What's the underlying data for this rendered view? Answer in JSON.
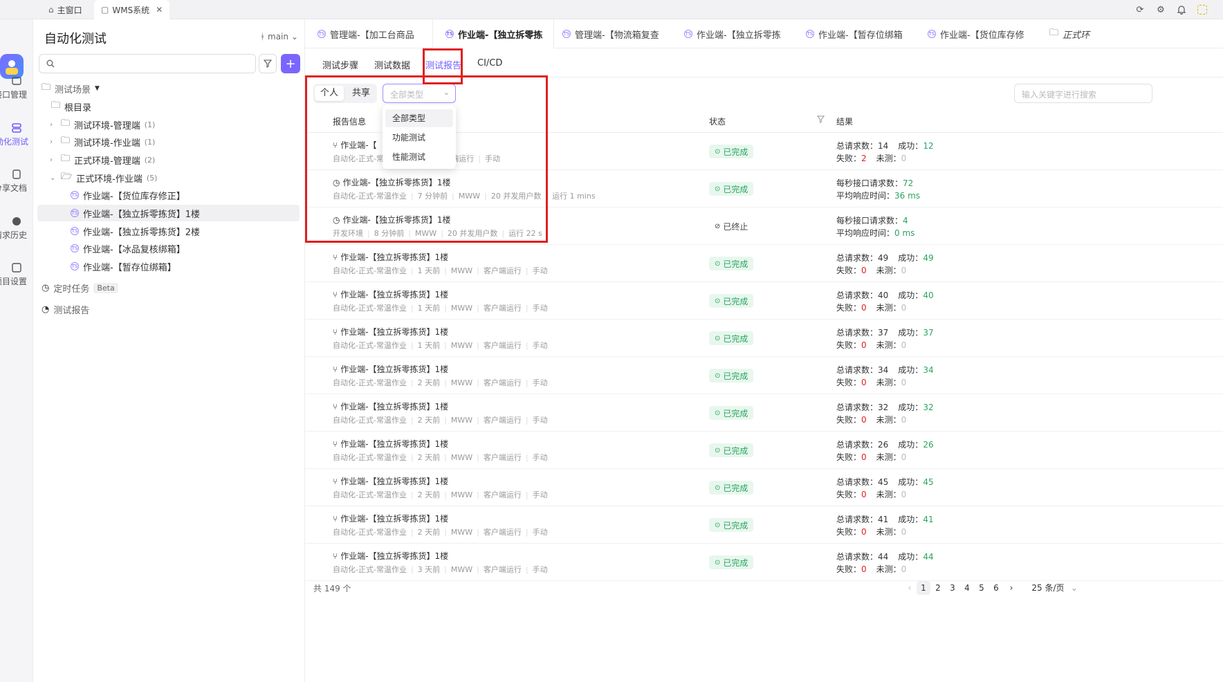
{
  "window": {
    "tabs": [
      {
        "label": "主窗口"
      },
      {
        "label": "WMS系统"
      }
    ]
  },
  "rail": {
    "items": [
      {
        "label": "接口管理"
      },
      {
        "label": "自动化测试"
      },
      {
        "label": "分享文档"
      },
      {
        "label": "请求历史"
      },
      {
        "label": "项目设置"
      }
    ]
  },
  "sidebar": {
    "title": "自动化测试",
    "branch": "main",
    "tree": [
      {
        "label": "测试场景"
      },
      {
        "label": "根目录"
      },
      {
        "label": "测试环境-管理端",
        "count": "(1)"
      },
      {
        "label": "测试环境-作业端",
        "count": "(1)"
      },
      {
        "label": "正式环境-管理端",
        "count": "(2)"
      },
      {
        "label": "正式环境-作业端",
        "count": "(5)"
      },
      {
        "label": "作业端-【货位库存修正】"
      },
      {
        "label": "作业端-【独立拆零拣货】1楼"
      },
      {
        "label": "作业端-【独立拆零拣货】2楼"
      },
      {
        "label": "作业端-【冰品复核绑箱】"
      },
      {
        "label": "作业端-【暂存位绑箱】"
      },
      {
        "label": "定时任务",
        "badge": "Beta"
      },
      {
        "label": "测试报告"
      }
    ]
  },
  "page_tabs": [
    "管理端-【加工台商品",
    "作业端-【独立拆零拣",
    "管理端-【物流箱复查",
    "作业端-【独立拆零拣",
    "作业端-【暂存位绑箱",
    "作业端-【货位库存修",
    "正式环"
  ],
  "sub_tabs": [
    "测试步骤",
    "测试数据",
    "测试报告",
    "CI/CD"
  ],
  "filters": {
    "personal": "个人",
    "shared": "共享",
    "type_placeholder": "全部类型",
    "keyword_placeholder": "输入关键字进行搜索",
    "type_options": [
      "全部类型",
      "功能测试",
      "性能测试"
    ]
  },
  "table": {
    "headers": {
      "info": "报告信息",
      "status": "状态",
      "result": "结果"
    },
    "rows": [
      {
        "title": "作业端-【",
        "meta": [
          "自动化-正式-常温作业",
          "W",
          "客户端运行",
          "手动"
        ],
        "status": "已完成",
        "r1": "总请求数：",
        "v1": "14",
        "r2": "成功：",
        "v2": "12",
        "r3": "失败：",
        "v3": "2",
        "r4": "未测：",
        "v4": "0"
      },
      {
        "title": "作业端-【独立拆零拣货】1楼",
        "meta": [
          "自动化-正式-常温作业",
          "7 分钟前",
          "MWW",
          "20 并发用户数",
          "运行 1 mins"
        ],
        "status": "已完成",
        "r1": "每秒接口请求数：",
        "v1": "72",
        "r3": "平均响应时间：",
        "v3": "36 ms"
      },
      {
        "title": "作业端-【独立拆零拣货】1楼",
        "meta": [
          "开发环境",
          "8 分钟前",
          "MWW",
          "20 并发用户数",
          "运行 22 s"
        ],
        "status": "已终止",
        "r1": "每秒接口请求数：",
        "v1": "4",
        "r3": "平均响应时间：",
        "v3": "0 ms"
      },
      {
        "title": "作业端-【独立拆零拣货】1楼",
        "meta": [
          "自动化-正式-常温作业",
          "1 天前",
          "MWW",
          "客户端运行",
          "手动"
        ],
        "status": "已完成",
        "r1": "总请求数：",
        "v1": "49",
        "r2": "成功：",
        "v2": "49",
        "r3": "失败：",
        "v3": "0",
        "r4": "未测：",
        "v4": "0"
      },
      {
        "title": "作业端-【独立拆零拣货】1楼",
        "meta": [
          "自动化-正式-常温作业",
          "1 天前",
          "MWW",
          "客户端运行",
          "手动"
        ],
        "status": "已完成",
        "r1": "总请求数：",
        "v1": "40",
        "r2": "成功：",
        "v2": "40",
        "r3": "失败：",
        "v3": "0",
        "r4": "未测：",
        "v4": "0"
      },
      {
        "title": "作业端-【独立拆零拣货】1楼",
        "meta": [
          "自动化-正式-常温作业",
          "1 天前",
          "MWW",
          "客户端运行",
          "手动"
        ],
        "status": "已完成",
        "r1": "总请求数：",
        "v1": "37",
        "r2": "成功：",
        "v2": "37",
        "r3": "失败：",
        "v3": "0",
        "r4": "未测：",
        "v4": "0"
      },
      {
        "title": "作业端-【独立拆零拣货】1楼",
        "meta": [
          "自动化-正式-常温作业",
          "2 天前",
          "MWW",
          "客户端运行",
          "手动"
        ],
        "status": "已完成",
        "r1": "总请求数：",
        "v1": "34",
        "r2": "成功：",
        "v2": "34",
        "r3": "失败：",
        "v3": "0",
        "r4": "未测：",
        "v4": "0"
      },
      {
        "title": "作业端-【独立拆零拣货】1楼",
        "meta": [
          "自动化-正式-常温作业",
          "2 天前",
          "MWW",
          "客户端运行",
          "手动"
        ],
        "status": "已完成",
        "r1": "总请求数：",
        "v1": "32",
        "r2": "成功：",
        "v2": "32",
        "r3": "失败：",
        "v3": "0",
        "r4": "未测：",
        "v4": "0"
      },
      {
        "title": "作业端-【独立拆零拣货】1楼",
        "meta": [
          "自动化-正式-常温作业",
          "2 天前",
          "MWW",
          "客户端运行",
          "手动"
        ],
        "status": "已完成",
        "r1": "总请求数：",
        "v1": "26",
        "r2": "成功：",
        "v2": "26",
        "r3": "失败：",
        "v3": "0",
        "r4": "未测：",
        "v4": "0"
      },
      {
        "title": "作业端-【独立拆零拣货】1楼",
        "meta": [
          "自动化-正式-常温作业",
          "2 天前",
          "MWW",
          "客户端运行",
          "手动"
        ],
        "status": "已完成",
        "r1": "总请求数：",
        "v1": "45",
        "r2": "成功：",
        "v2": "45",
        "r3": "失败：",
        "v3": "0",
        "r4": "未测：",
        "v4": "0"
      },
      {
        "title": "作业端-【独立拆零拣货】1楼",
        "meta": [
          "自动化-正式-常温作业",
          "2 天前",
          "MWW",
          "客户端运行",
          "手动"
        ],
        "status": "已完成",
        "r1": "总请求数：",
        "v1": "41",
        "r2": "成功：",
        "v2": "41",
        "r3": "失败：",
        "v3": "0",
        "r4": "未测：",
        "v4": "0"
      },
      {
        "title": "作业端-【独立拆零拣货】1楼",
        "meta": [
          "自动化-正式-常温作业",
          "3 天前",
          "MWW",
          "客户端运行",
          "手动"
        ],
        "status": "已完成",
        "r1": "总请求数：",
        "v1": "44",
        "r2": "成功：",
        "v2": "44",
        "r3": "失败：",
        "v3": "0",
        "r4": "未测：",
        "v4": "0"
      }
    ]
  },
  "pagination": {
    "total": "共 149 个",
    "pages": [
      "1",
      "2",
      "3",
      "4",
      "5",
      "6"
    ],
    "per_page": "25 条/页"
  },
  "colors": {
    "accent": "#6e5bff",
    "success": "#2ba360",
    "danger": "#e02020",
    "highlight_box": "#e02020"
  }
}
